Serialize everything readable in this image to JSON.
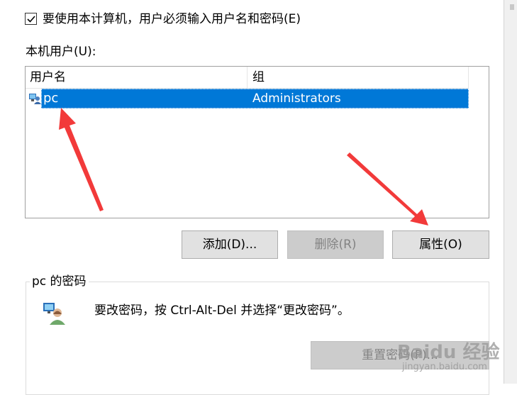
{
  "checkbox": {
    "checked": true,
    "label": "要使用本计算机，用户必须输入用户名和密码(E)"
  },
  "users_label": "本机用户(U):",
  "listview": {
    "columns": [
      "用户名",
      "组"
    ],
    "rows": [
      {
        "user": "pc",
        "group": "Administrators",
        "selected": true
      }
    ]
  },
  "buttons": {
    "add": "添加(D)...",
    "remove": "删除(R)",
    "properties": "属性(O)",
    "reset_password": "重置密码(P)..."
  },
  "password_group": {
    "title": "pc 的密码",
    "text": "要改密码，按 Ctrl-Alt-Del 并选择“更改密码”。"
  },
  "watermark": {
    "logo": "Baidu 经验",
    "url": "jingyan.baidu.com"
  },
  "colors": {
    "selection": "#0078d7",
    "arrow": "#f23a3a",
    "button": "#e1e1e1"
  },
  "icons": [
    "checkmark-icon",
    "user-icon",
    "users-key-icon"
  ]
}
